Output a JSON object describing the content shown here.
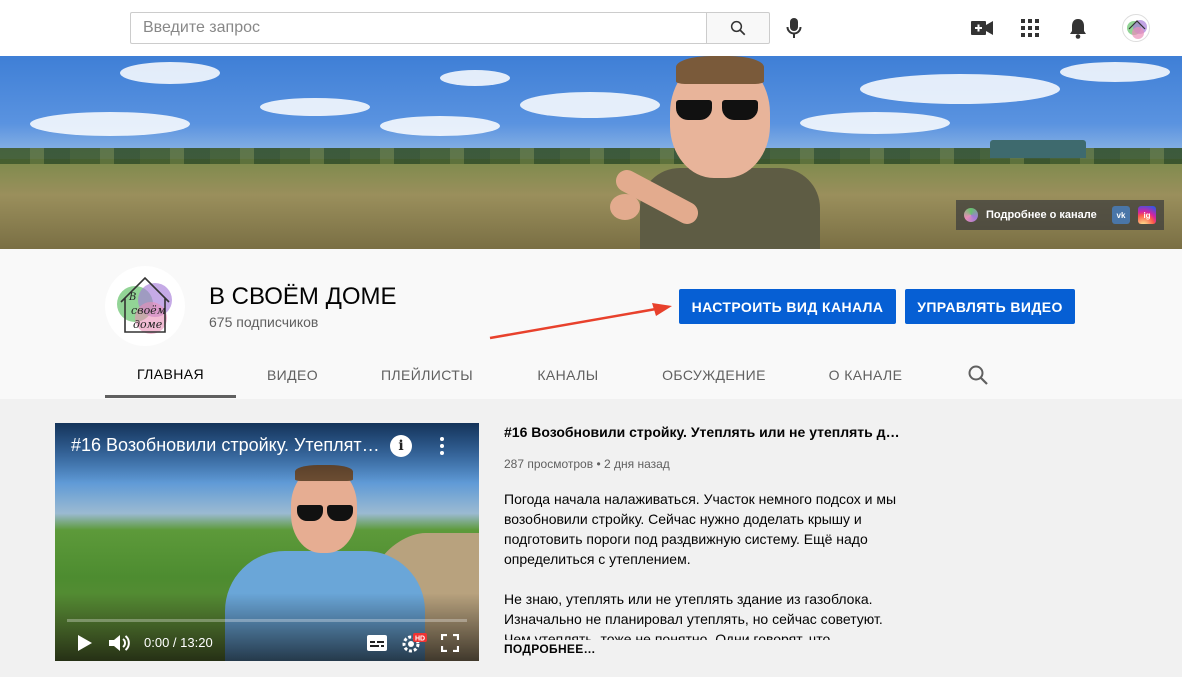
{
  "search": {
    "placeholder": "Введите запрос"
  },
  "top_icons": [
    "search-icon",
    "mic-icon",
    "video-camera-plus-icon",
    "apps-grid-icon",
    "bell-icon",
    "channel-avatar"
  ],
  "banner": {
    "links_label": "Подробнее о канале",
    "social": [
      {
        "name": "vk",
        "text": "vk"
      },
      {
        "name": "instagram",
        "text": "ig"
      }
    ]
  },
  "channel": {
    "avatar_lines": [
      "В",
      "своём",
      "доме"
    ],
    "title": "В СВОЁМ ДОМЕ",
    "subscribers": "675 подписчиков",
    "customize_button": "НАСТРОИТЬ ВИД КАНАЛА",
    "manage_button": "УПРАВЛЯТЬ ВИДЕО"
  },
  "tabs": [
    {
      "label": "ГЛАВНАЯ",
      "active": true
    },
    {
      "label": "ВИДЕО"
    },
    {
      "label": "ПЛЕЙЛИСТЫ"
    },
    {
      "label": "КАНАЛЫ"
    },
    {
      "label": "ОБСУЖДЕНИЕ"
    },
    {
      "label": "О КАНАЛЕ"
    }
  ],
  "video": {
    "player_title": "#16 Возобновили стройку. Утеплят…",
    "time": "0:00 / 13:20",
    "hd_badge": "HD",
    "title": "#16 Возобновили стройку. Утеплять или не утеплять до…",
    "views": "287 просмотров",
    "separator": "•",
    "date": "2 дня назад",
    "description": [
      "Погода начала налаживаться. Участок немного подсох и мы возобновили стройку. Сейчас нужно доделать крышу и подготовить пороги под раздвижную систему. Ещё надо определиться с утеплением.",
      "Не знаю, утеплять или не утеплять здание из газоблока. Изначально не планировал утеплять, но сейчас советуют. Чем утеплять, тоже не понятно. Одни говорят, что"
    ],
    "more": "ПОДРОБНЕЕ…"
  },
  "colors": {
    "brand_blue": "#065fd4",
    "arrow": "#e8412c",
    "text_secondary": "#606060"
  }
}
